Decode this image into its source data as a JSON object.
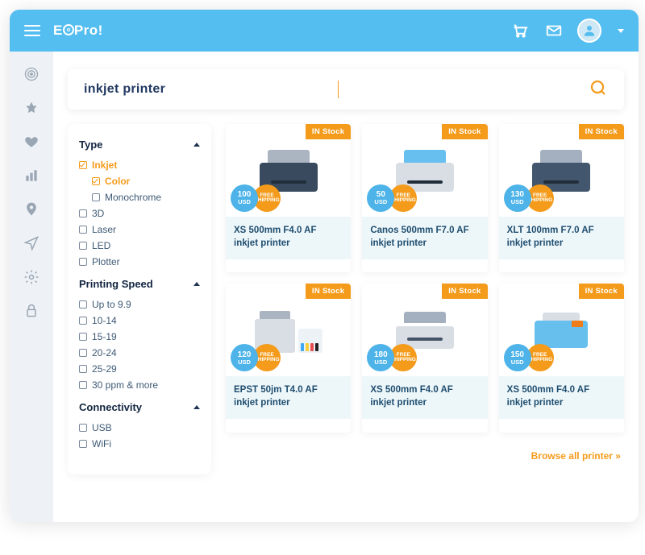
{
  "brand": "E",
  "brand_suffix": "Pro!",
  "search_value": "inkjet printer",
  "filters": {
    "type": {
      "title": "Type",
      "items": [
        {
          "label": "Inkjet",
          "checked": true,
          "sub": [
            {
              "label": "Color",
              "checked": true
            },
            {
              "label": "Monochrome",
              "checked": false
            }
          ]
        },
        {
          "label": "3D",
          "checked": false
        },
        {
          "label": "Laser",
          "checked": false
        },
        {
          "label": "LED",
          "checked": false
        },
        {
          "label": "Plotter",
          "checked": false
        }
      ]
    },
    "speed": {
      "title": "Printing Speed",
      "items": [
        {
          "label": "Up to 9.9"
        },
        {
          "label": "10-14"
        },
        {
          "label": "15-19"
        },
        {
          "label": "20-24"
        },
        {
          "label": "25-29"
        },
        {
          "label": "30 ppm & more"
        }
      ]
    },
    "conn": {
      "title": "Connectivity",
      "items": [
        {
          "label": "USB"
        },
        {
          "label": "WiFi"
        }
      ]
    }
  },
  "stock_label": "IN Stock",
  "ship_label": "FREE SHIPPING",
  "currency": "USD",
  "products": [
    {
      "name": "XS 500mm F4.0 AF inkjet printer",
      "price": "100",
      "variant": "1"
    },
    {
      "name": "Canos 500mm F7.0 AF inkjet printer",
      "price": "50",
      "variant": "2"
    },
    {
      "name": "XLT 100mm F7.0 AF inkjet printer",
      "price": "130",
      "variant": "3"
    },
    {
      "name": "EPST 50jm T4.0 AF inkjet printer",
      "price": "120",
      "variant": "4"
    },
    {
      "name": "XS 500mm F4.0 AF inkjet printer",
      "price": "180",
      "variant": "5"
    },
    {
      "name": "XS 500mm F4.0 AF inkjet printer",
      "price": "150",
      "variant": "6"
    }
  ],
  "browse_all": "Browse all printer »"
}
